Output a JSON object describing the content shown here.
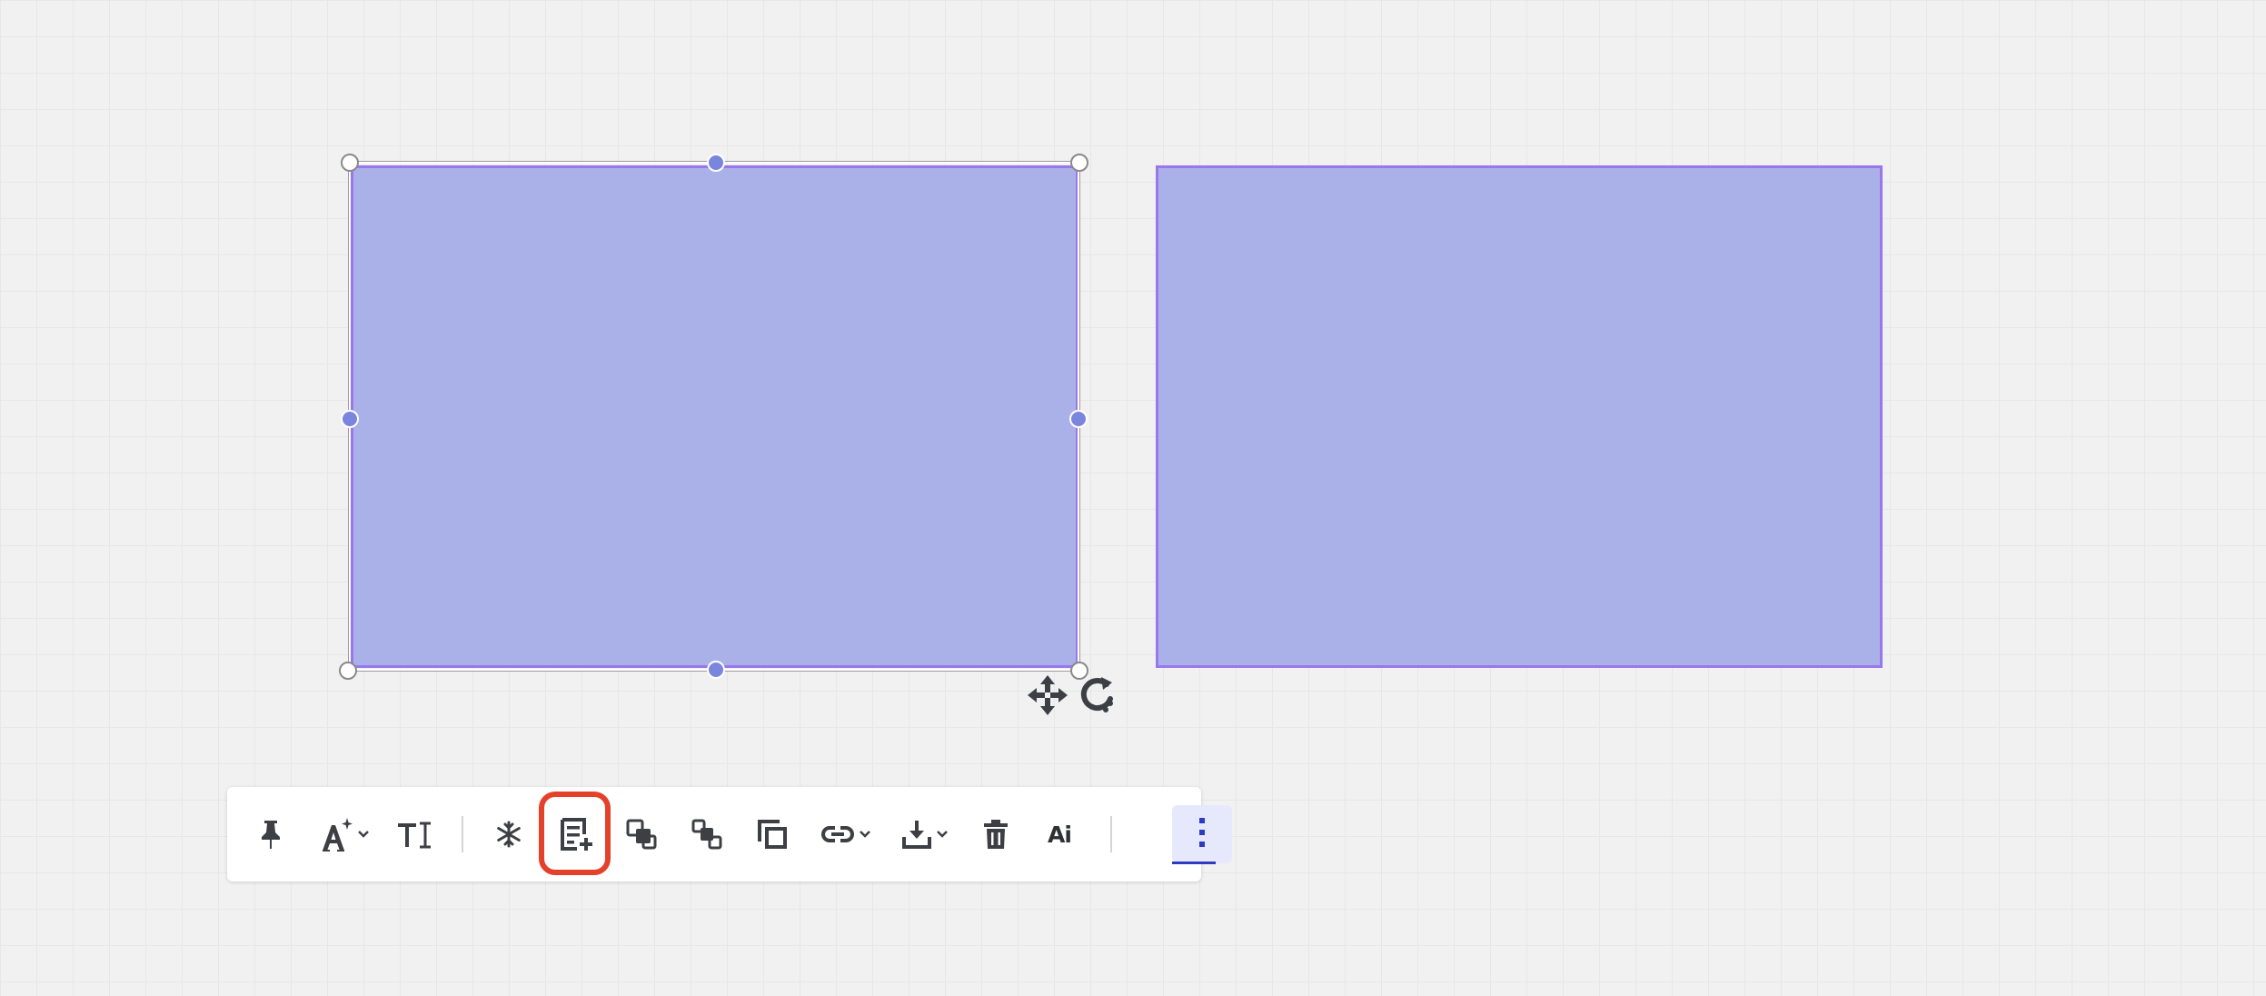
{
  "canvas": {
    "shapes": [
      {
        "name": "left-rectangle",
        "fill": "#aab0e8",
        "stroke": "#9a78ec",
        "selected": true
      },
      {
        "name": "right-rectangle",
        "fill": "#aab0e8",
        "stroke": "#9a78ec",
        "selected": false
      }
    ]
  },
  "selection": {
    "handles": [
      "top-left",
      "top-center",
      "top-right",
      "middle-left",
      "middle-right",
      "bottom-left",
      "bottom-center",
      "bottom-right"
    ],
    "move_icon": "move-arrows-icon",
    "rotate_icon": "rotate-icon"
  },
  "toolbar": {
    "items": [
      {
        "id": "pin",
        "icon": "pin-icon"
      },
      {
        "id": "text-style",
        "icon": "font-sparkle-icon",
        "dropdown": true
      },
      {
        "id": "text-size",
        "icon": "text-size-icon"
      },
      {
        "id": "freeze",
        "icon": "snowflake-icon"
      },
      {
        "id": "add-text",
        "icon": "text-add-icon",
        "highlighted": true
      },
      {
        "id": "bring-forward",
        "icon": "bring-forward-icon"
      },
      {
        "id": "send-backward",
        "icon": "send-backward-icon"
      },
      {
        "id": "duplicate",
        "icon": "duplicate-icon"
      },
      {
        "id": "link",
        "icon": "link-icon",
        "dropdown": true
      },
      {
        "id": "download",
        "icon": "download-icon",
        "dropdown": true
      },
      {
        "id": "delete",
        "icon": "trash-icon"
      },
      {
        "id": "ai",
        "icon": "ai-icon"
      },
      {
        "id": "more",
        "icon": "more-vertical-icon",
        "active": true
      }
    ],
    "ai_label": "Ai"
  },
  "colors": {
    "shape_fill": "#aab0e8",
    "shape_stroke": "#9a78ec",
    "highlight": "#e5412a",
    "active_accent": "#2f39c4"
  }
}
